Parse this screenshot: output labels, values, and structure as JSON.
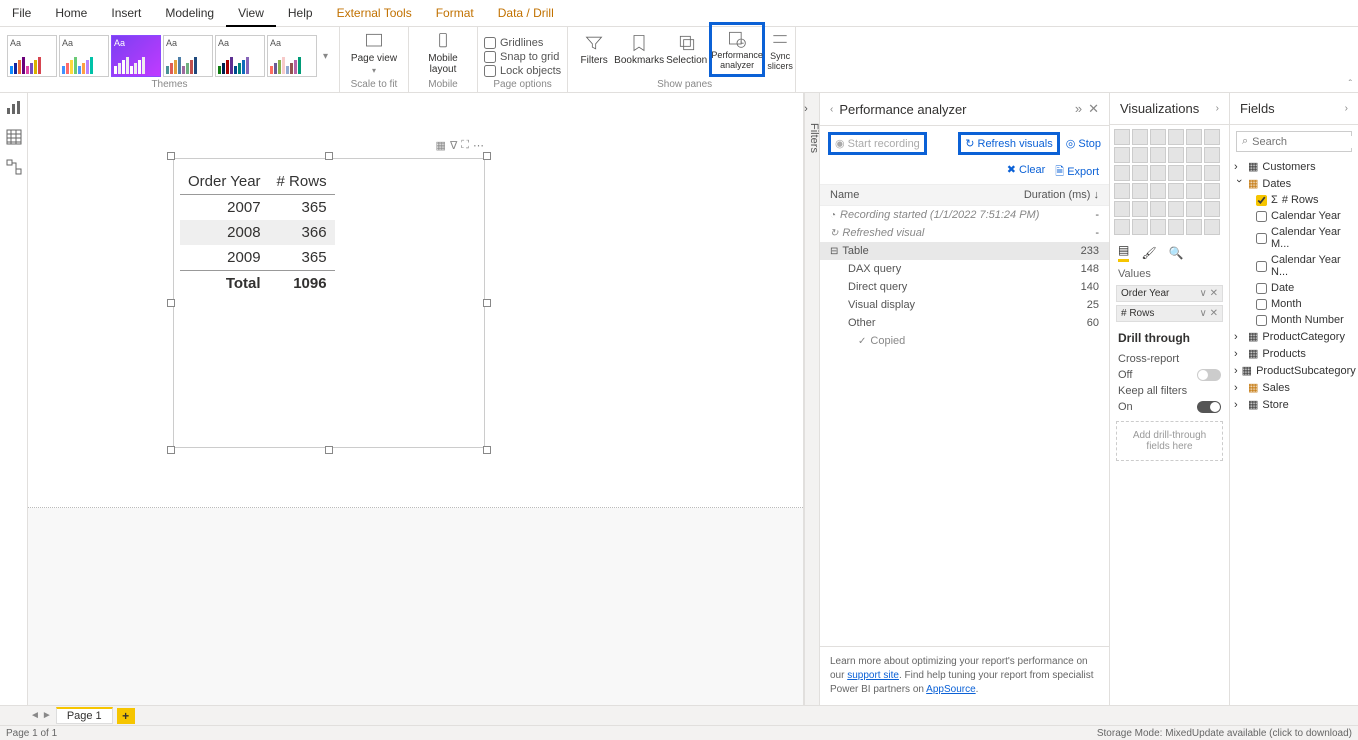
{
  "menubar": [
    "File",
    "Home",
    "Insert",
    "Modeling",
    "View",
    "Help",
    "External Tools",
    "Format",
    "Data / Drill"
  ],
  "menubar_active": "View",
  "menubar_orange": [
    "External Tools",
    "Format",
    "Data / Drill"
  ],
  "ribbon": {
    "themes_label": "Themes",
    "scale_label": "Scale to fit",
    "mobile_label": "Mobile",
    "page_options_label": "Page options",
    "show_panes_label": "Show panes",
    "page_view": "Page view",
    "mobile_layout": "Mobile layout",
    "gridlines": "Gridlines",
    "snap": "Snap to grid",
    "lock": "Lock objects",
    "filters": "Filters",
    "bookmarks": "Bookmarks",
    "selection": "Selection",
    "perf": "Performance analyzer",
    "sync": "Sync slicers"
  },
  "visual": {
    "headers": [
      "Order Year",
      "# Rows"
    ],
    "rows": [
      {
        "year": "2007",
        "rows": "365"
      },
      {
        "year": "2008",
        "rows": "366"
      },
      {
        "year": "2009",
        "rows": "365"
      }
    ],
    "total_label": "Total",
    "total_value": "1096"
  },
  "filters_tab": "Filters",
  "perf": {
    "title": "Performance analyzer",
    "start": "Start recording",
    "refresh": "Refresh visuals",
    "stop": "Stop",
    "clear": "Clear",
    "export": "Export",
    "name_col": "Name",
    "dur_col": "Duration (ms)",
    "rows": [
      {
        "name": "Recording started (1/1/2022 7:51:24 PM)",
        "dur": "-",
        "kind": "italic",
        "icon": "◔"
      },
      {
        "name": "Refreshed visual",
        "dur": "-",
        "kind": "italic",
        "icon": "↻"
      },
      {
        "name": "Table",
        "dur": "233",
        "kind": "sel",
        "icon": "⊟"
      },
      {
        "name": "DAX query",
        "dur": "148",
        "kind": "indent"
      },
      {
        "name": "Direct query",
        "dur": "140",
        "kind": "indent"
      },
      {
        "name": "Visual display",
        "dur": "25",
        "kind": "indent"
      },
      {
        "name": "Other",
        "dur": "60",
        "kind": "indent"
      },
      {
        "name": "Copied",
        "dur": "",
        "kind": "indent2",
        "icon": "✓"
      }
    ],
    "footer1": "Learn more about optimizing your report's performance on our ",
    "footer_link1": "support site",
    "footer2": ". Find help tuning your report from specialist Power BI partners on ",
    "footer_link2": "AppSource"
  },
  "viz": {
    "title": "Visualizations",
    "values_label": "Values",
    "value_pills": [
      "Order Year",
      "# Rows"
    ],
    "drill_title": "Drill through",
    "cross": "Cross-report",
    "off": "Off",
    "keep": "Keep all filters",
    "on": "On",
    "drop": "Add drill-through fields here"
  },
  "fields": {
    "title": "Fields",
    "search_placeholder": "Search",
    "tables": [
      {
        "name": "Customers",
        "expanded": false
      },
      {
        "name": "Dates",
        "expanded": true,
        "yellow": true,
        "fields": [
          {
            "name": "# Rows",
            "checked": true,
            "sigma": true
          },
          {
            "name": "Calendar Year"
          },
          {
            "name": "Calendar Year M..."
          },
          {
            "name": "Calendar Year N..."
          },
          {
            "name": "Date"
          },
          {
            "name": "Month"
          },
          {
            "name": "Month Number"
          }
        ]
      },
      {
        "name": "ProductCategory",
        "expanded": false
      },
      {
        "name": "Products",
        "expanded": false
      },
      {
        "name": "ProductSubcategory",
        "expanded": false
      },
      {
        "name": "Sales",
        "expanded": false,
        "yellow": true
      },
      {
        "name": "Store",
        "expanded": false
      }
    ]
  },
  "page_tabs": {
    "page": "Page 1"
  },
  "status": {
    "left": "Page 1 of 1",
    "right": "Storage Mode: MixedUpdate available (click to download)"
  }
}
